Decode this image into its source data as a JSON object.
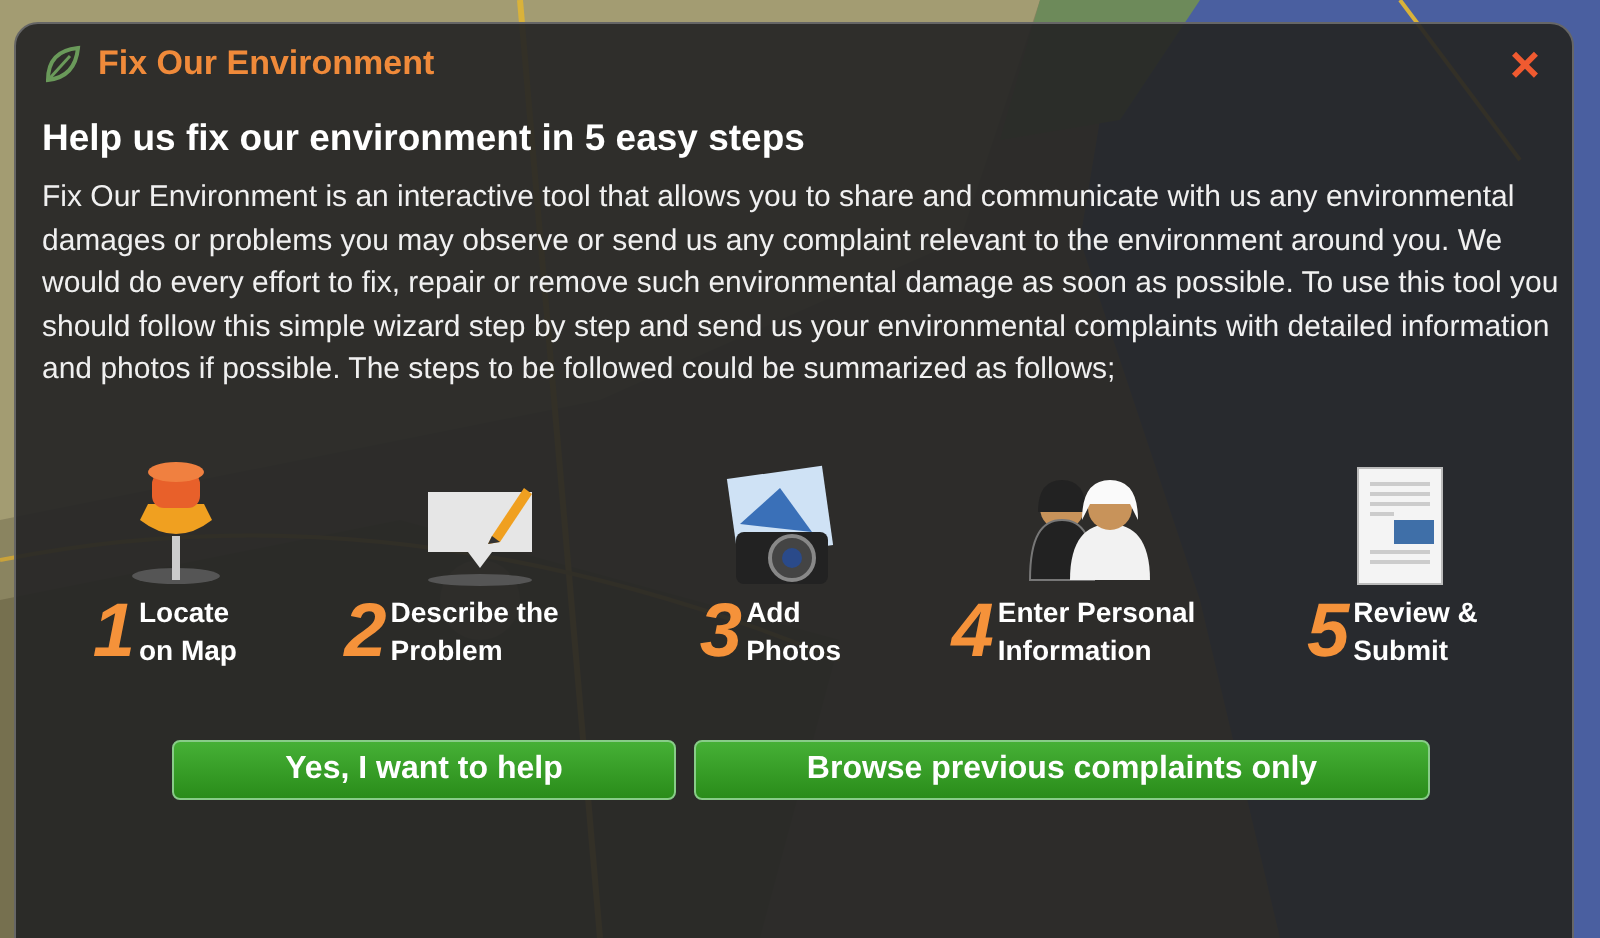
{
  "dialog": {
    "title": "Fix Our Environment",
    "close": "×",
    "heading": "Help us fix our environment in 5 easy steps",
    "description": "Fix Our Environment is an interactive tool that allows you to share and communicate with us any environmental damages or problems you may observe or send us any complaint relevant to the environment around you. We would do every effort to fix, repair or remove such environmental damage as soon as possible. To use this tool you should follow this simple wizard step by step and send us your environmental complaints with detailed information and photos if possible. The steps to be followed could be summarized as follows;",
    "steps": [
      {
        "number": "1",
        "label": "Locate on Map"
      },
      {
        "number": "2",
        "label": "Describe the Problem"
      },
      {
        "number": "3",
        "label": "Add Photos"
      },
      {
        "number": "4",
        "label": "Enter Personal Information"
      },
      {
        "number": "5",
        "label": "Review & Submit"
      }
    ],
    "buttons": [
      "Yes, I want to help",
      "Browse previous complaints only"
    ]
  }
}
